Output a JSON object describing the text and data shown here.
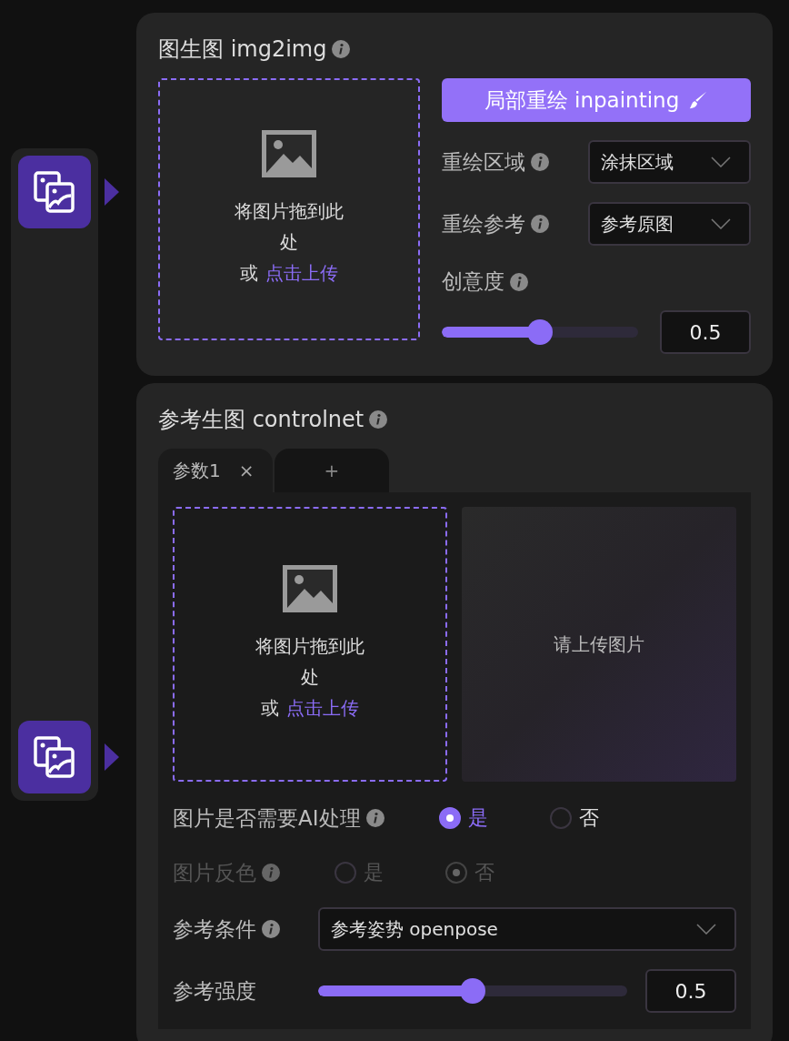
{
  "img2img": {
    "title": "图生图 img2img",
    "upload": {
      "prompt": "将图片拖到此处",
      "or": "或",
      "link": "点击上传"
    },
    "inpaint_button": "局部重绘 inpainting",
    "fields": [
      {
        "kind": "select",
        "label": "重绘区域",
        "info": true,
        "value": "涂抹区域"
      },
      {
        "kind": "select",
        "label": "重绘参考",
        "info": true,
        "value": "参考原图"
      },
      {
        "kind": "slider",
        "label": "创意度",
        "info": true,
        "level": 0.5,
        "value": "0.5"
      }
    ]
  },
  "controlnet": {
    "title": "参考生图 controlnet",
    "tabs": [
      {
        "label": "参数1",
        "close": "×",
        "selected": true
      },
      {
        "label": "+",
        "selected": false
      }
    ],
    "upload": {
      "prompt": "将图片拖到此处",
      "or": "或",
      "link": "点击上传"
    },
    "preview": {
      "text": "请上传图片"
    },
    "rows": [
      {
        "kind": "radio",
        "label": "图片是否需要AI处理",
        "info": true,
        "disabled": false,
        "options": [
          {
            "label": "是",
            "selected": true
          },
          {
            "label": "否",
            "selected": false
          }
        ]
      },
      {
        "kind": "radio",
        "label": "图片反色",
        "info": true,
        "disabled": true,
        "options": [
          {
            "label": "是",
            "selected": false
          },
          {
            "label": "否",
            "selected": true
          }
        ]
      },
      {
        "kind": "select",
        "label": "参考条件",
        "info": true,
        "value": "参考姿势 openpose"
      },
      {
        "kind": "slider",
        "label": "参考强度",
        "info": false,
        "level": 0.5,
        "value": "0.5"
      }
    ]
  }
}
